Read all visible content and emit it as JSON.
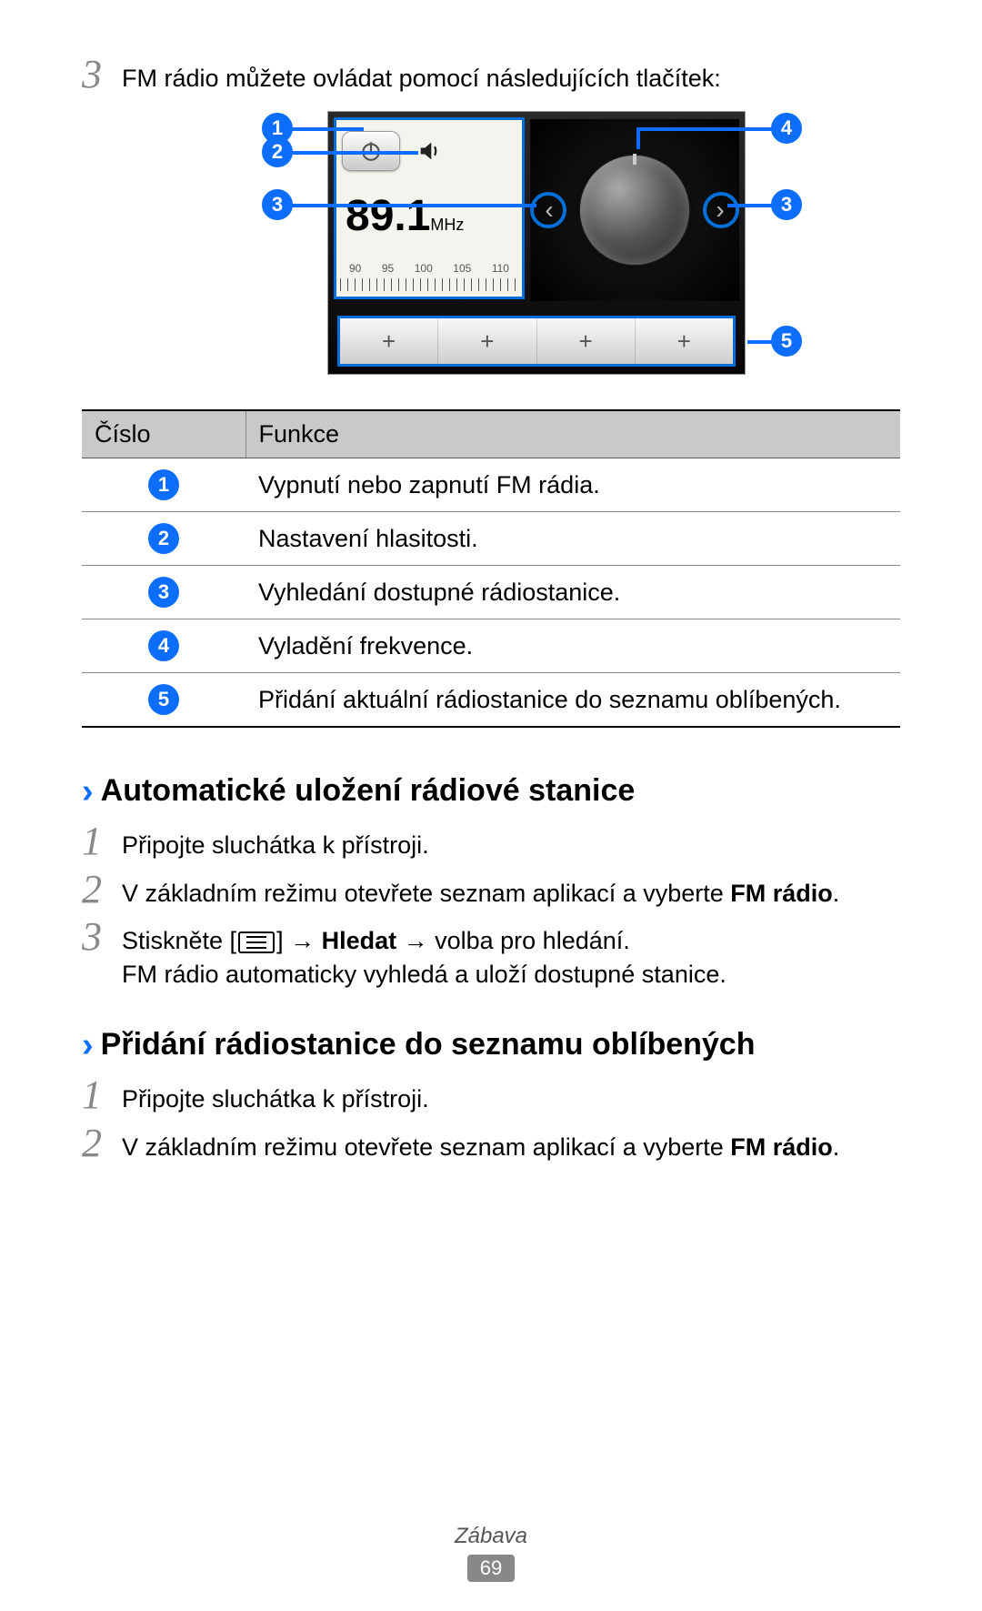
{
  "top": {
    "step_num": "3",
    "step_text": "FM rádio můžete ovládat pomocí následujících tlačítek:"
  },
  "radio": {
    "frequency": "89.1",
    "unit": "MHz",
    "ruler": [
      "90",
      "95",
      "100",
      "105",
      "110"
    ]
  },
  "callouts": {
    "c1": "1",
    "c2": "2",
    "c3": "3",
    "c4": "4",
    "c5": "5",
    "c3b": "3"
  },
  "table": {
    "h1": "Číslo",
    "h2": "Funkce",
    "rows": [
      {
        "n": "1",
        "f": "Vypnutí nebo zapnutí FM rádia."
      },
      {
        "n": "2",
        "f": "Nastavení hlasitosti."
      },
      {
        "n": "3",
        "f": "Vyhledání dostupné rádiostanice."
      },
      {
        "n": "4",
        "f": "Vyladění frekvence."
      },
      {
        "n": "5",
        "f": "Přidání aktuální rádiostanice do seznamu oblíbených."
      }
    ]
  },
  "sect1": {
    "title": "Automatické uložení rádiové stanice",
    "s1_num": "1",
    "s1": "Připojte sluchátka k přístroji.",
    "s2_num": "2",
    "s2_a": "V základním režimu otevřete seznam aplikací a vyberte ",
    "s2_b": "FM rádio",
    "s2_c": ".",
    "s3_num": "3",
    "s3_a": "Stiskněte [",
    "s3_b": "] → ",
    "s3_c": "Hledat",
    "s3_d": " → volba pro hledání.",
    "s3_e": "FM rádio automaticky vyhledá a uloží dostupné stanice."
  },
  "sect2": {
    "title": "Přidání rádiostanice do seznamu oblíbených",
    "s1_num": "1",
    "s1": "Připojte sluchátka k přístroji.",
    "s2_num": "2",
    "s2_a": "V základním režimu otevřete seznam aplikací a vyberte ",
    "s2_b": "FM rádio",
    "s2_c": "."
  },
  "footer": {
    "section": "Zábava",
    "page": "69"
  }
}
